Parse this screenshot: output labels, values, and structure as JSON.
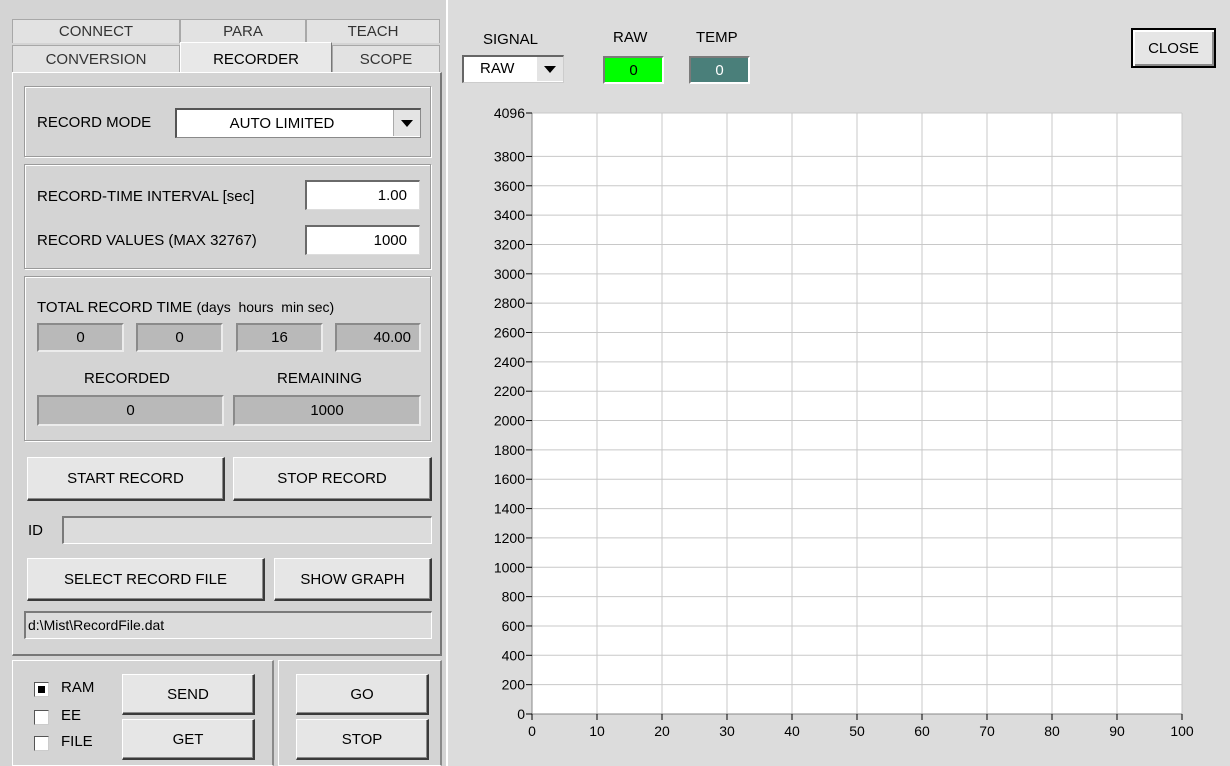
{
  "tabs": {
    "row1": [
      "CONNECT",
      "PARA",
      "TEACH"
    ],
    "row2": [
      "CONVERSION",
      "RECORDER",
      "SCOPE"
    ],
    "active": "RECORDER"
  },
  "record_mode": {
    "label": "RECORD MODE",
    "value": "AUTO LIMITED"
  },
  "interval": {
    "label": "RECORD-TIME INTERVAL [sec]",
    "value": "1.00"
  },
  "values": {
    "label": "RECORD VALUES (MAX 32767)",
    "value": "1000"
  },
  "total": {
    "label": "TOTAL RECORD TIME",
    "sublabel": "(days  hours  min sec)",
    "days": "0",
    "hours": "0",
    "min": "16",
    "sec": "40.00"
  },
  "recorded": {
    "label": "RECORDED",
    "value": "0"
  },
  "remaining": {
    "label": "REMAINING",
    "value": "1000"
  },
  "buttons": {
    "start": "START RECORD",
    "stop": "STOP RECORD",
    "select_file": "SELECT RECORD FILE",
    "show_graph": "SHOW GRAPH",
    "send": "SEND",
    "get": "GET",
    "go": "GO",
    "stop2": "STOP",
    "close": "CLOSE"
  },
  "id_label": "ID",
  "id_value": "",
  "file_path": "d:\\Mist\\RecordFile.dat",
  "memory": {
    "ram": {
      "label": "RAM",
      "checked": true
    },
    "ee": {
      "label": "EE",
      "checked": false
    },
    "file": {
      "label": "FILE",
      "checked": false
    }
  },
  "signal": {
    "label": "SIGNAL",
    "value": "RAW"
  },
  "raw": {
    "label": "RAW",
    "value": "0",
    "color": "#00ff00"
  },
  "temp": {
    "label": "TEMP",
    "value": "0",
    "color": "#4a7f7a"
  },
  "chart_data": {
    "type": "line",
    "xlim": [
      0,
      100
    ],
    "ylim": [
      0,
      4096
    ],
    "x_ticks": [
      0,
      10,
      20,
      30,
      40,
      50,
      60,
      70,
      80,
      90,
      100
    ],
    "y_ticks": [
      0,
      200,
      400,
      600,
      800,
      1000,
      1200,
      1400,
      1600,
      1800,
      2000,
      2200,
      2400,
      2600,
      2800,
      3000,
      3200,
      3400,
      3600,
      3800,
      4096
    ],
    "series": [],
    "grid": true
  }
}
